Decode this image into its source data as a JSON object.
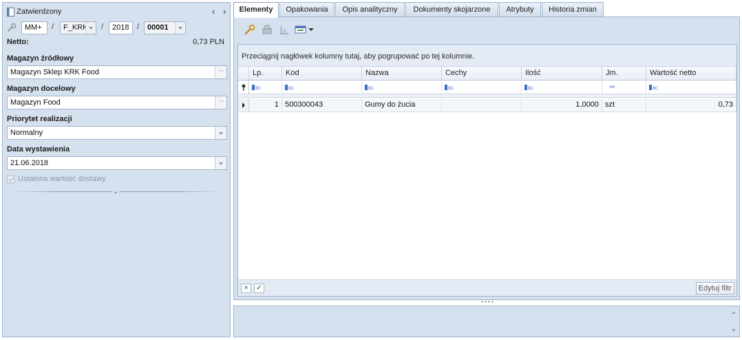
{
  "header": {
    "status": "Zatwierdzony",
    "prev_icon": "chevron-left",
    "next_icon": "chevron-right"
  },
  "document_number": {
    "type": "MM+",
    "series": "F_KRK",
    "year": "2018",
    "number": "00001",
    "separator": "/"
  },
  "netto": {
    "label": "Netto:",
    "value": "0,73 PLN"
  },
  "source_warehouse": {
    "label": "Magazyn źródłowy",
    "value": "Magazyn Sklep KRK Food",
    "button": "···"
  },
  "target_warehouse": {
    "label": "Magazyn docelowy",
    "value": "Magazyn Food",
    "button": "···"
  },
  "priority": {
    "label": "Priorytet realizacji",
    "value": "Normalny"
  },
  "issue_date": {
    "label": "Data wystawienia",
    "value": "21.06.2018"
  },
  "fixed_delivery_value": {
    "label": "Ustalona wartość dostawy",
    "checked": true
  },
  "tabs": [
    {
      "label": "Elementy",
      "active": true
    },
    {
      "label": "Opakowania",
      "active": false
    },
    {
      "label": "Opis analityczny",
      "active": false
    },
    {
      "label": "Dokumenty skojarzone",
      "active": false
    },
    {
      "label": "Atrybuty",
      "active": false
    },
    {
      "label": "Historia zmian",
      "active": false
    }
  ],
  "toolbar": {
    "icons": [
      "wrench-icon",
      "batch-icon",
      "chart-icon",
      "view-icon",
      "dropdown-arrow-icon"
    ]
  },
  "grid": {
    "group_hint": "Przeciągnij nagłówek kolumny tutaj, aby pogrupować po tej kolumnie.",
    "columns": [
      "Lp.",
      "Kod",
      "Nazwa",
      "Cechy",
      "Ilość",
      "Jm.",
      "Wartość netto"
    ],
    "rows": [
      {
        "lp": "1",
        "kod": "500300043",
        "nazwa": "Gumy do żucia",
        "cechy": "",
        "ilosc": "1,0000",
        "jm": "szt",
        "wartosc": "0,73"
      }
    ],
    "footer": {
      "clear_icon": "×",
      "check_icon": "✓",
      "edit_filter": "Edytuj filtr"
    }
  },
  "colors": {
    "panel_bg": "#d6e1ef",
    "border": "#9fb3cf",
    "accent": "#3b6fc4"
  }
}
